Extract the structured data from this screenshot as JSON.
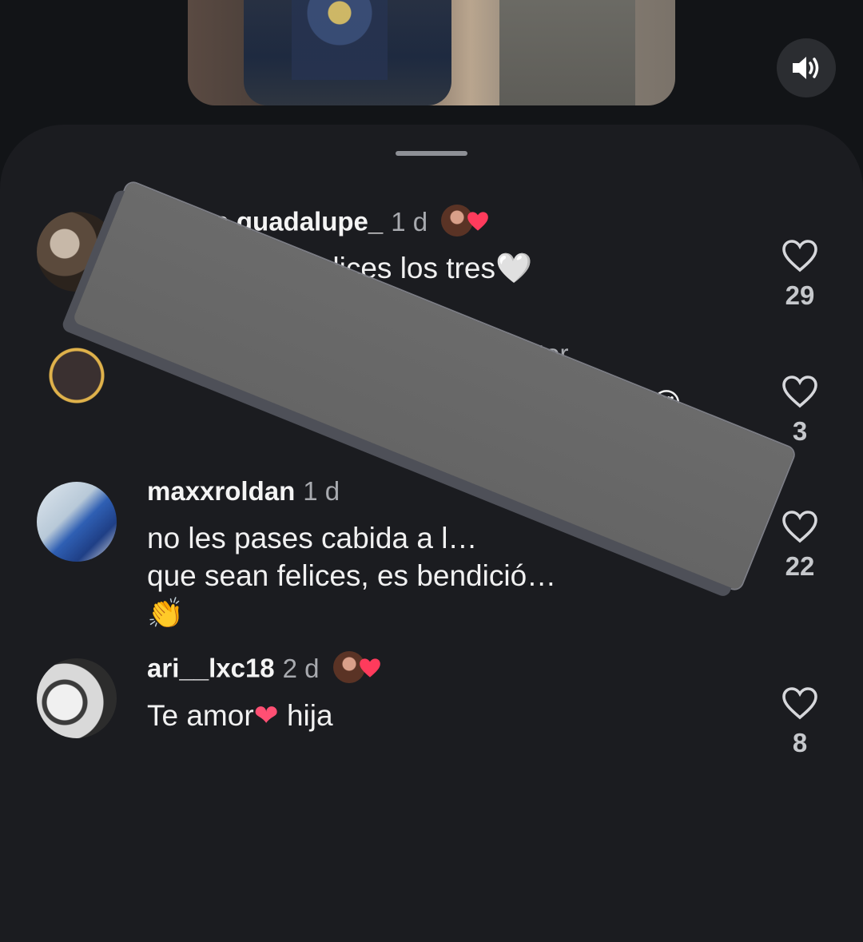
{
  "video": {
    "sound_icon": "speaker-icon"
  },
  "comments": [
    {
      "username": "…rena.guadalupe_",
      "time": "1 d",
      "text": "…ro q sean felices los tres🤍",
      "likes": "29",
      "liked_by_creator": true
    },
    {
      "username": "",
      "time": "",
      "partial_meta": "…tor",
      "text": "…ias 😍",
      "likes": "3",
      "liked_by_creator": false
    },
    {
      "username": "maxxroldan",
      "time": "1 d",
      "text_line1": "no les pases cabida a l…",
      "text_line2": "que sean felices, es bendició…",
      "text_line3": "👏",
      "likes": "22",
      "liked_by_creator": true
    },
    {
      "username": "ari__lxc18",
      "time": "2 d",
      "text_a": "Te amor",
      "text_heart": "❤",
      "text_b": " hija",
      "likes": "8",
      "liked_by_creator": true
    }
  ],
  "colors": {
    "background": "#121417",
    "sheet": "#1b1c20",
    "like_heart": "#ff3b5c"
  }
}
